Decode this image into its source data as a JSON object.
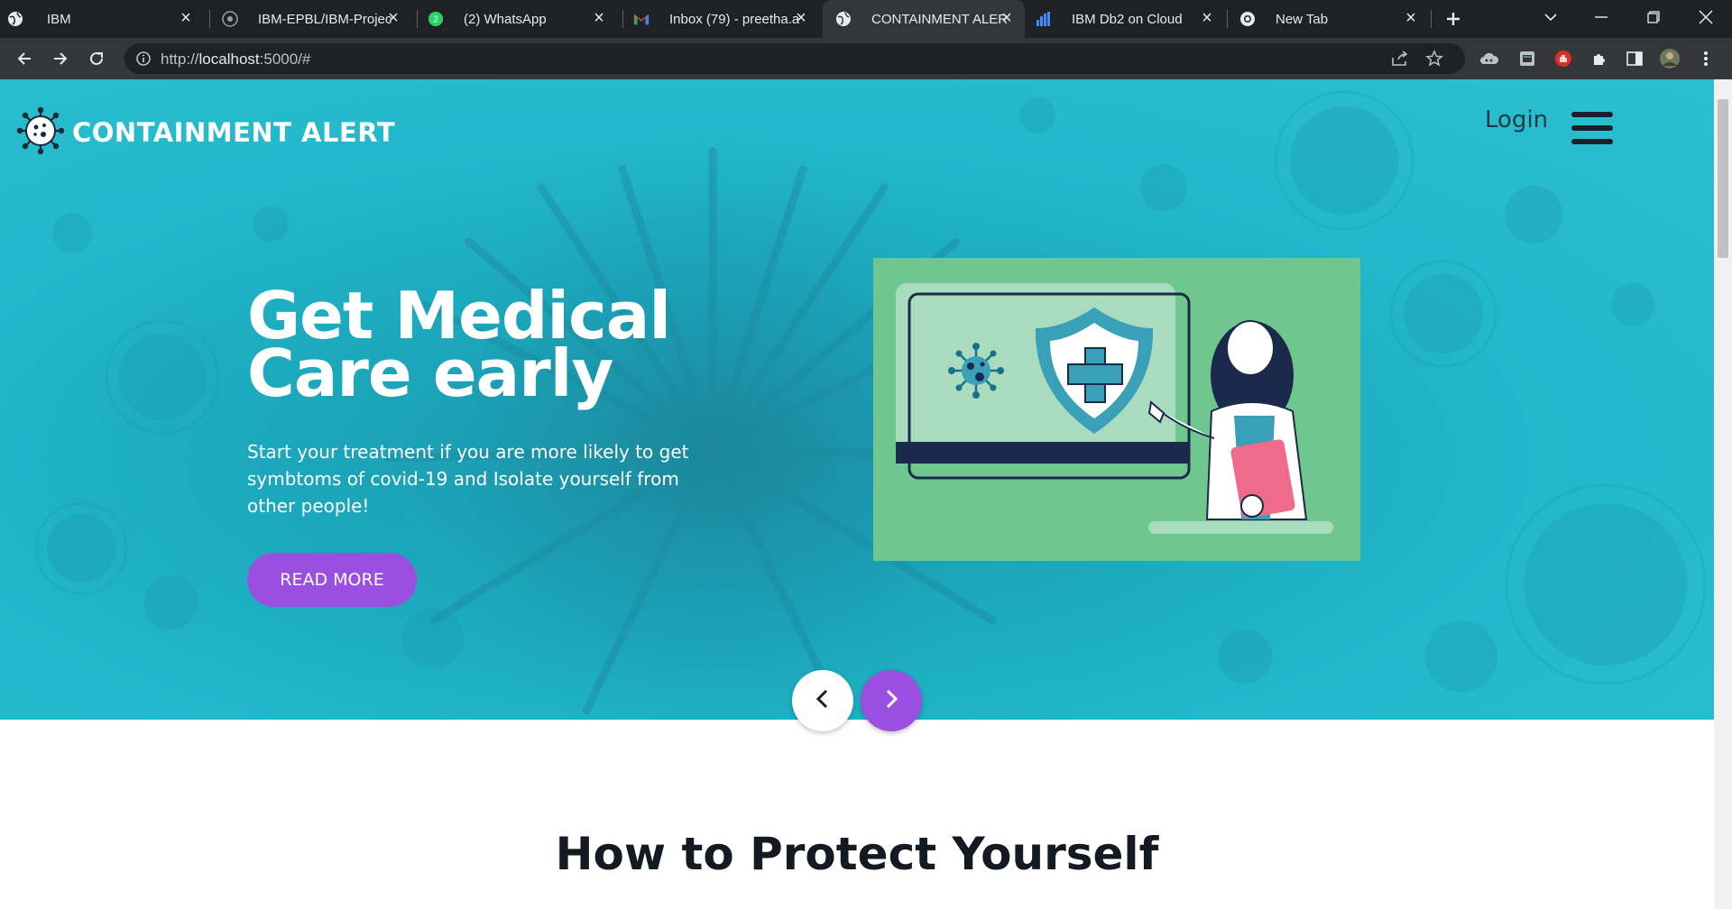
{
  "browser": {
    "tabs": [
      {
        "title": "IBM",
        "icon": "globe-icon",
        "active": false
      },
      {
        "title": "IBM-EPBL/IBM-Projec",
        "icon": "github-icon",
        "active": false
      },
      {
        "title": "(2) WhatsApp",
        "icon": "whatsapp-icon",
        "active": false
      },
      {
        "title": "Inbox (79) - preetha.a",
        "icon": "gmail-icon",
        "active": false
      },
      {
        "title": "CONTAINMENT ALERT",
        "icon": "globe-icon",
        "active": true
      },
      {
        "title": "IBM Db2 on Cloud",
        "icon": "db2-icon",
        "active": false
      },
      {
        "title": "New Tab",
        "icon": "chrome-icon",
        "active": false
      }
    ],
    "url_prefix": "http://",
    "url_host": "localhost",
    "url_rest": ":5000/#"
  },
  "site": {
    "brand": "CONTAINMENT ALERT",
    "login": "Login"
  },
  "hero": {
    "headline_line1": "Get Medical",
    "headline_line2": "Care early",
    "subtext": "Start your treatment if you are more likely to get symbtoms of covid-19 and Isolate yourself from other people!",
    "button": "READ MORE"
  },
  "section": {
    "title": "How to Protect Yourself"
  },
  "colors": {
    "accent": "#9b4fe0",
    "hero_bg": "#22b8cb",
    "illustration_bg": "#6fc78f"
  }
}
